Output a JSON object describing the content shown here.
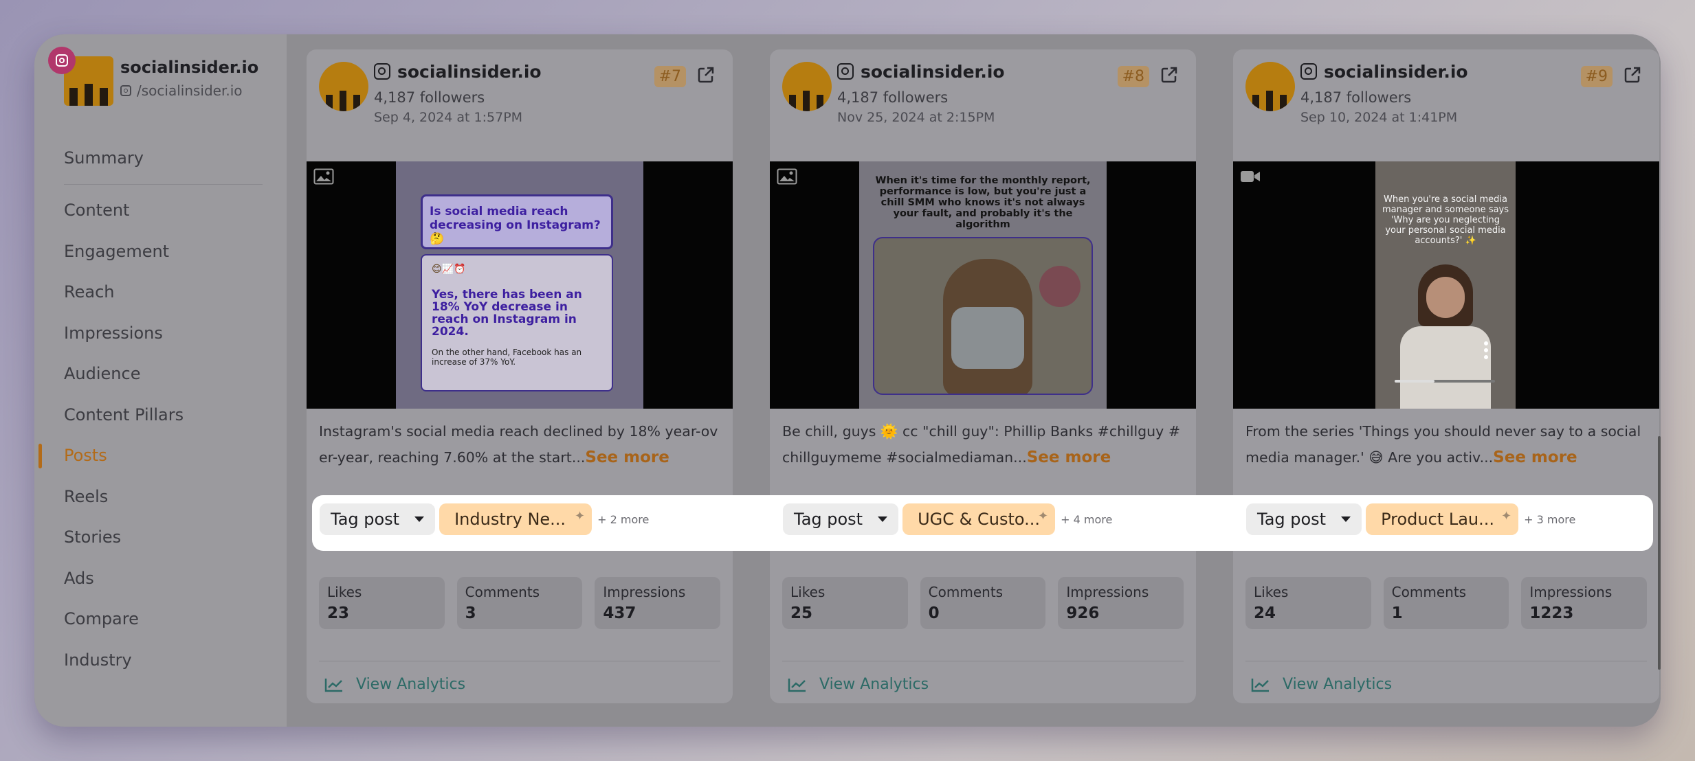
{
  "sidebar": {
    "brand_name": "socialinsider.io",
    "brand_handle": "/socialinsider.io",
    "items": [
      {
        "label": "Summary"
      },
      {
        "label": "Content"
      },
      {
        "label": "Engagement"
      },
      {
        "label": "Reach"
      },
      {
        "label": "Impressions"
      },
      {
        "label": "Audience"
      },
      {
        "label": "Content Pillars"
      },
      {
        "label": "Posts",
        "active": true
      },
      {
        "label": "Reels"
      },
      {
        "label": "Stories"
      },
      {
        "label": "Ads"
      },
      {
        "label": "Compare"
      },
      {
        "label": "Industry"
      }
    ]
  },
  "posts": [
    {
      "name": "socialinsider.io",
      "followers": "4,187 followers",
      "date": "Sep 4, 2024 at 1:57PM",
      "rank": "#7",
      "media_type": "image-icon",
      "media_text": {
        "question": "Is social media reach decreasing on Instagram? 🤔",
        "answer": "Yes, there has been an 18% YoY decrease in reach on Instagram in 2024.",
        "note": "On the other hand, Facebook has an increase of 37% YoY.",
        "emojis": "😊📈⏰"
      },
      "caption": "Instagram's social media reach declined by 18% year-over-year, reaching 7.60% at the start...",
      "see_more": "See more",
      "tag_label": "Tag post",
      "tag": "Industry Ne...",
      "more": "+ 2 more",
      "likes_label": "Likes",
      "likes": "23",
      "comments_label": "Comments",
      "comments": "3",
      "impressions_label": "Impressions",
      "impressions": "437",
      "view_analytics": "View Analytics"
    },
    {
      "name": "socialinsider.io",
      "followers": "4,187 followers",
      "date": "Nov 25, 2024 at 2:15PM",
      "rank": "#8",
      "media_type": "image-icon",
      "media_text": {
        "headline": "When it's time for the monthly report, performance is low, but you're just a chill SMM who knows it's not always your fault, and probably it's the algorithm"
      },
      "caption": "Be chill, guys 🌞 cc \"chill guy\": Phillip Banks #chillguy #chillguymeme #socialmediaman...",
      "see_more": "See more",
      "tag_label": "Tag post",
      "tag": "UGC & Custo...",
      "more": "+ 4 more",
      "likes_label": "Likes",
      "likes": "25",
      "comments_label": "Comments",
      "comments": "0",
      "impressions_label": "Impressions",
      "impressions": "926",
      "view_analytics": "View Analytics"
    },
    {
      "name": "socialinsider.io",
      "followers": "4,187 followers",
      "date": "Sep 10, 2024 at 1:41PM",
      "rank": "#9",
      "media_type": "video-icon",
      "media_text": {
        "overlay": "When you're a social media manager and someone says 'Why are you neglecting your personal social media accounts?' ✨"
      },
      "caption": "From the series 'Things you should never say to a social media manager.' 😅 Are you activ...",
      "see_more": "See more",
      "tag_label": "Tag post",
      "tag": "Product Lau...",
      "more": "+ 3 more",
      "likes_label": "Likes",
      "likes": "24",
      "comments_label": "Comments",
      "comments": "1",
      "impressions_label": "Impressions",
      "impressions": "1223",
      "view_analytics": "View Analytics"
    }
  ]
}
